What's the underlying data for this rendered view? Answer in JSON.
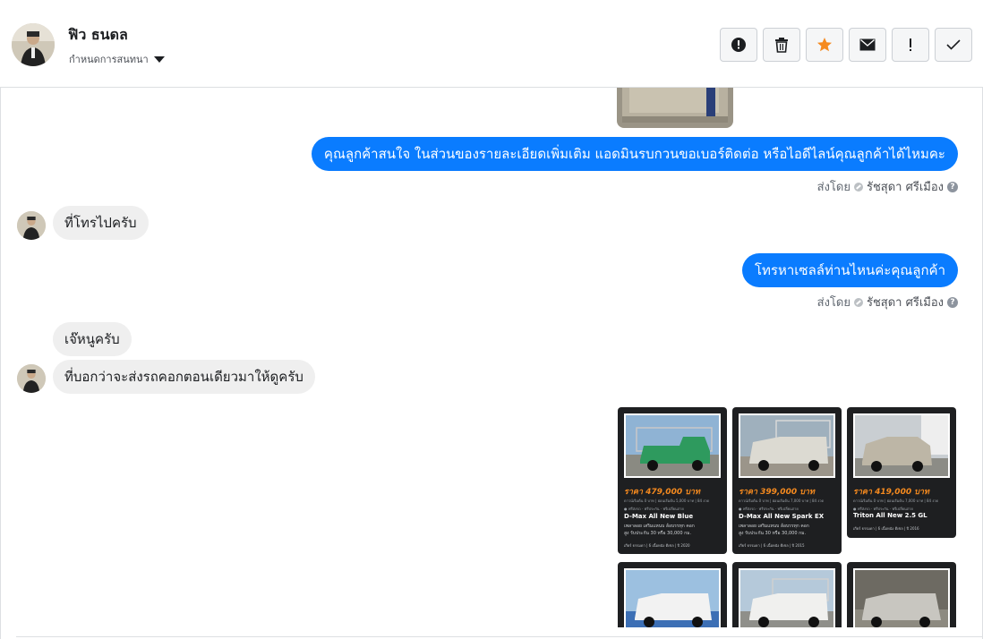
{
  "header": {
    "contact_name": "ฟิว ธนดล",
    "assign_label": "กำหนดการสนทนา",
    "actions": [
      {
        "name": "mark-spam-button",
        "icon": "alert-circle-icon",
        "active": false
      },
      {
        "name": "delete-button",
        "icon": "trash-icon",
        "active": false
      },
      {
        "name": "star-button",
        "icon": "star-icon",
        "active": true
      },
      {
        "name": "mark-unread-button",
        "icon": "envelope-icon",
        "active": false
      },
      {
        "name": "follow-up-button",
        "icon": "exclamation-icon",
        "active": false
      },
      {
        "name": "mark-done-button",
        "icon": "check-icon",
        "active": false
      }
    ],
    "star_color": "#f58a1f"
  },
  "messages": [
    {
      "direction": "outgoing",
      "text": "คุณลูกค้าสนใจ ในส่วนของรายละเอียดเพิ่มเติม แอดมินรบกวนขอเบอร์ติดต่อ หรือไอดีไลน์คุณลูกค้าได้ไหมคะ",
      "sent_by_label": "ส่งโดย",
      "agent": "รัชสุดา ศรีเมือง"
    },
    {
      "direction": "incoming",
      "text": "ที่โทรไปครับ"
    },
    {
      "direction": "outgoing",
      "text": "โทรหาเซลล์ท่านไหนค่ะคุณลูกค้า",
      "sent_by_label": "ส่งโดย",
      "agent": "รัชสุดา ศรีเมือง"
    },
    {
      "direction": "incoming",
      "text": "เจ๊หนูครับ"
    },
    {
      "direction": "incoming",
      "text": "ที่บอกว่าจะส่งรถคอกตอนเดียวมาให้ดูครับ"
    }
  ],
  "car_cards": [
    {
      "price": "ราคา 479,000 บาท",
      "model": "D-Max All New Blue",
      "desc1": "เพลาลอย เสริมแหนบ ล้อบรรทุก คอก",
      "desc2": "สูง รับประกัน 30 หรือ 30,000 กม.",
      "meta": "เกียร์ ธรรมดา  |  6 เนื้อหนัง ดีเซล  |  ปี 2020",
      "photo_color": "#2e9a5e"
    },
    {
      "price": "ราคา 399,000 บาท",
      "model": "D-Max All New Spark EX",
      "desc1": "เพลาลอย เสริมแหนบ ล้อบรรทุก คอก",
      "desc2": "สูง รับประกัน 30 หรือ 30,000 กม.",
      "meta": "เกียร์ ธรรมดา  |  6 เนื้อหนัง ดีเซล  |  ปี 2015",
      "photo_color": "#c9c7bd"
    },
    {
      "price": "ราคา 419,000 บาท",
      "model": "Triton All New 2.5 GL",
      "desc1": "",
      "desc2": "",
      "meta": "เกียร์ ธรรมดา  |  6 เนื้อหนัง ดีเซล  |  ปี 2016",
      "photo_color": "#b7b1a3"
    }
  ],
  "sent_by_label": "ส่งโดย"
}
